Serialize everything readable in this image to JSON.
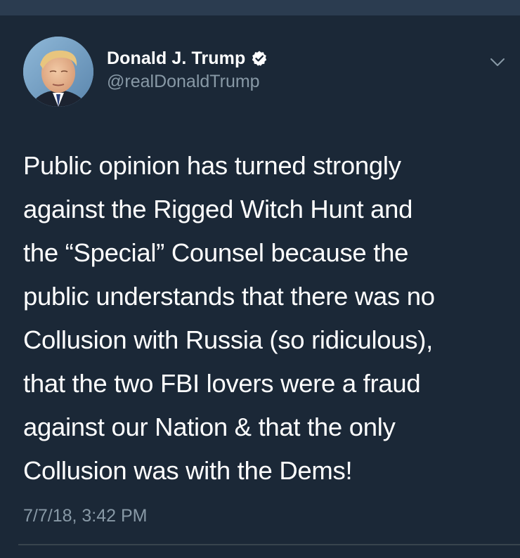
{
  "colors": {
    "background": "#1b2837",
    "top_strip": "#2b3c50",
    "text_primary": "#ffffff",
    "text_secondary": "#8899a6",
    "verified": "#ffffff",
    "divider": "#38444d"
  },
  "tweet": {
    "author": {
      "display_name": "Donald J. Trump",
      "handle": "@realDonaldTrump",
      "verified": true,
      "avatar_icon": "profile-photo"
    },
    "text": "Public opinion has turned strongly\nagainst the Rigged Witch Hunt and\nthe “Special” Counsel because the\npublic understands that there was no\nCollusion with Russia (so ridiculous),\nthat the two FBI lovers were a fraud\nagainst our Nation & that the only\nCollusion was with the Dems!",
    "timestamp": "7/7/18, 3:42 PM",
    "menu_icon": "chevron-down-icon"
  }
}
